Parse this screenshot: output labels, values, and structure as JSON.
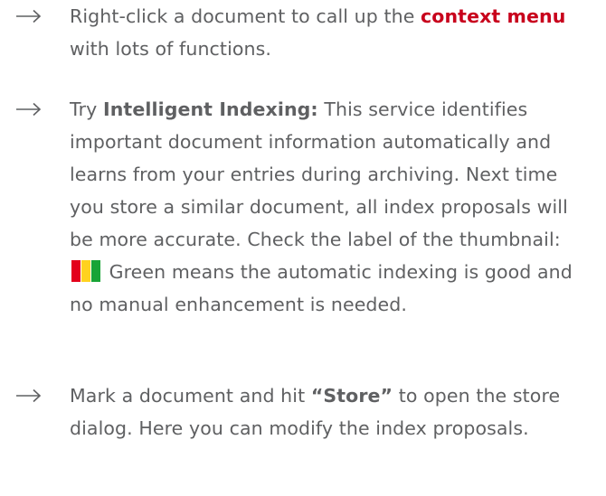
{
  "tips": [
    {
      "parts": [
        "Right-click a document to call up the ",
        "context menu",
        " with lots of functions."
      ]
    },
    {
      "parts": [
        "Try ",
        "Intelligent Indexing:",
        " This service identifies important document information automatically and learns from your entries during archiving. Next time you store a similar document, all index proposals will be more accurate. Check the label of the thumbnail: ",
        " Green means the automatic indexing is good and no manual enhancement is needed."
      ]
    },
    {
      "parts": [
        "Mark a document and hit ",
        "“Store”",
        " to open the store dialog. Here you can modify the index proposals."
      ]
    }
  ],
  "label_colors": {
    "red": "#e3001b",
    "yellow": "#ffd21f",
    "green": "#18a436"
  },
  "icons": {
    "bullet": "right-arrow-icon"
  }
}
